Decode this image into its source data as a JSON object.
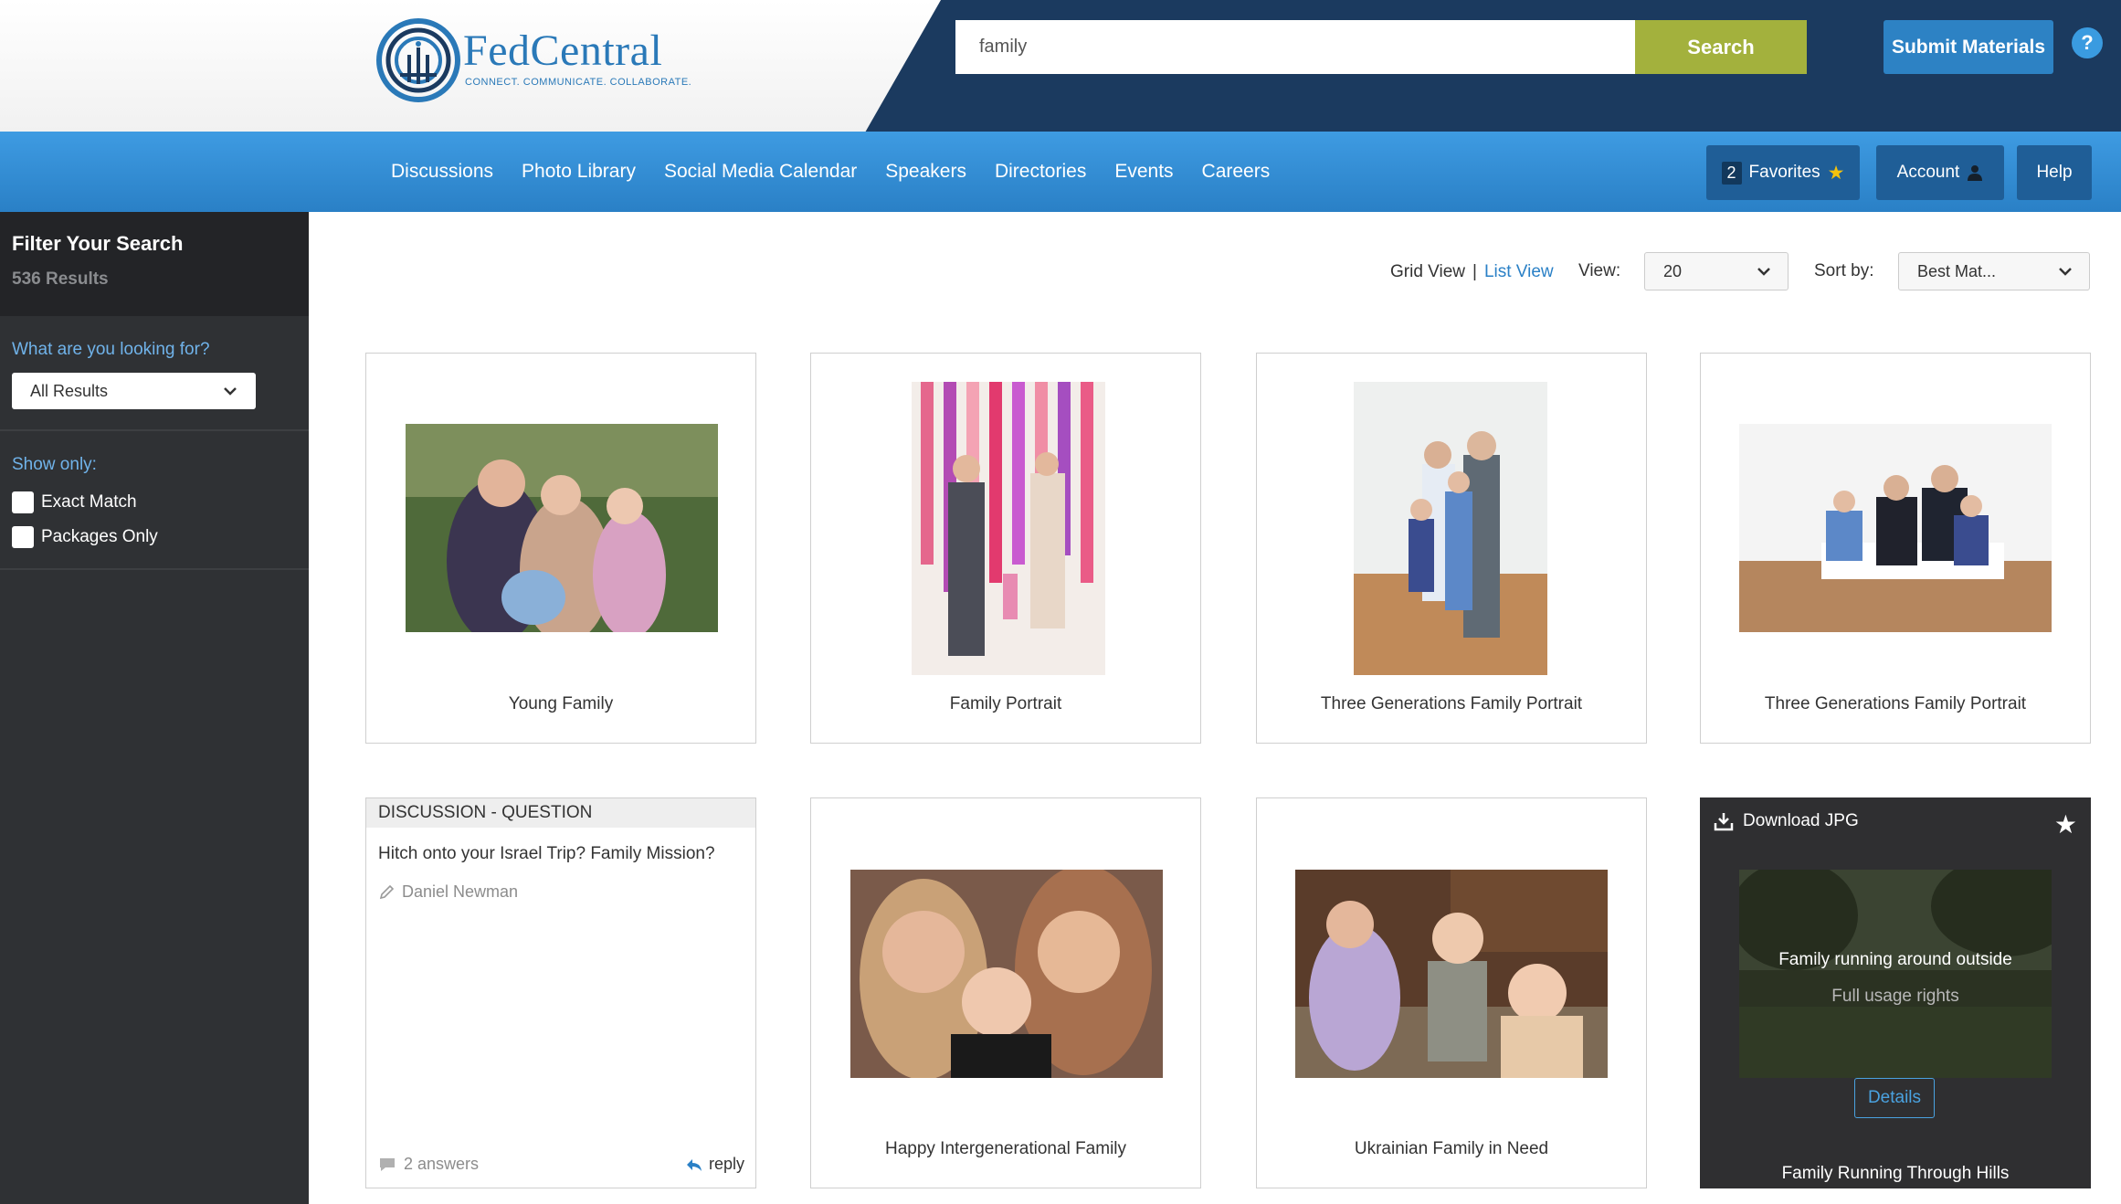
{
  "brand": {
    "name": "FedCentral",
    "tagline": "CONNECT. COMMUNICATE. COLLABORATE.",
    "accent": "#2a79b8"
  },
  "header": {
    "search_value": "family",
    "search_button": "Search",
    "submit_button": "Submit Materials",
    "help_icon": "?"
  },
  "nav": {
    "links": [
      "Discussions",
      "Photo Library",
      "Social Media Calendar",
      "Speakers",
      "Directories",
      "Events",
      "Careers"
    ],
    "favorites_count": "2",
    "favorites_label": "Favorites",
    "account_label": "Account",
    "help_label": "Help"
  },
  "sidebar": {
    "title": "Filter Your Search",
    "results": "536 Results",
    "looking_for_label": "What are you looking for?",
    "looking_for_value": "All Results",
    "show_only_label": "Show only:",
    "options": [
      "Exact Match",
      "Packages Only"
    ]
  },
  "toolbar": {
    "grid_view": "Grid View",
    "separator": "|",
    "list_view": "List View",
    "view_label": "View:",
    "view_value": "20",
    "sort_label": "Sort by:",
    "sort_value": "Best Mat..."
  },
  "cards": {
    "young_family": "Young Family",
    "family_portrait": "Family Portrait",
    "three_gen_1": "Three Generations Family Portrait",
    "three_gen_2": "Three Generations Family Portrait",
    "discussion": {
      "type": "DISCUSSION - QUESTION",
      "title": "Hitch onto your Israel Trip? Family Mission?",
      "author": "Daniel Newman",
      "answers": "2 answers",
      "reply": "reply"
    },
    "happy_family": "Happy Intergenerational Family",
    "ukrainian_family": "Ukrainian Family in Need",
    "hover_card": {
      "download": "Download JPG",
      "overlay_title": "Family running around outside",
      "overlay_sub": "Full usage rights",
      "details": "Details",
      "caption": "Family Running Through Hills"
    }
  }
}
